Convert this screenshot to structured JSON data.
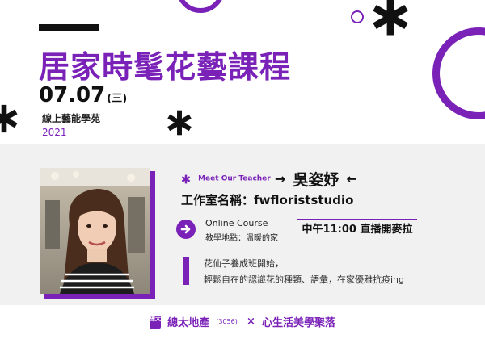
{
  "header": {
    "title": "居家時髦花藝課程",
    "date": "07.07",
    "weekday": "(三)",
    "organizer": "線上藝能學苑",
    "year": "2021"
  },
  "teacher": {
    "meet_label": "Meet Our Teacher",
    "left_arrow": "→",
    "name": "吳姿妤",
    "right_arrow": "←",
    "studio": "工作室名稱：fwfloriststudio"
  },
  "course": {
    "arrow_icon": "arrow-right-icon",
    "online_label": "Online Course",
    "location": "教學地點：溫暖的家",
    "time": "中午11:00 直播開麥拉"
  },
  "description": {
    "line1": "花仙子養成班開始，",
    "line2": "輕鬆自在的認識花的種類、語彙，在家優雅抗疫ing"
  },
  "footer": {
    "logo_text": "總太",
    "sponsor": "總太地產",
    "code": "(3056)",
    "times": "×",
    "partner": "心生活美學聚落"
  },
  "colors": {
    "accent": "#7a22b8",
    "band": "#f1f1f1",
    "text": "#111111"
  }
}
